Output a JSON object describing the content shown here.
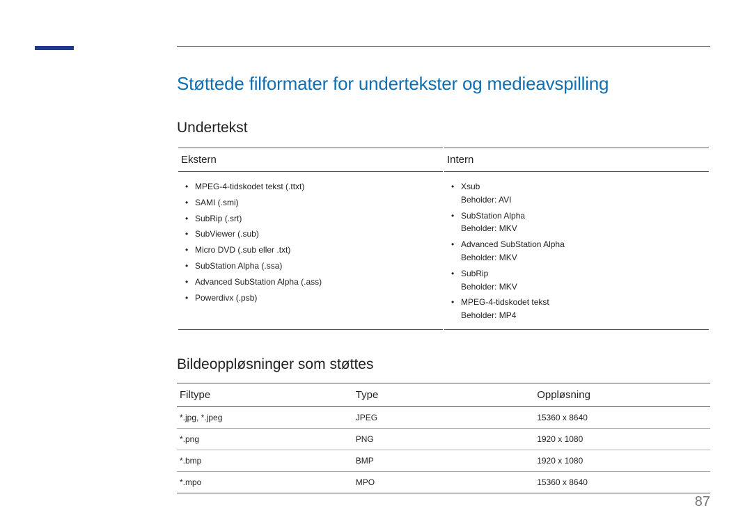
{
  "title": "Støttede filformater for undertekster og medieavspilling",
  "section1": {
    "heading": "Undertekst",
    "col1_header": "Ekstern",
    "col2_header": "Intern",
    "external": [
      {
        "text": "MPEG-4-tidskodet tekst (.ttxt)"
      },
      {
        "text": "SAMI (.smi)"
      },
      {
        "text": "SubRip (.srt)"
      },
      {
        "text": "SubViewer (.sub)"
      },
      {
        "text": "Micro DVD (.sub eller .txt)"
      },
      {
        "text": "SubStation Alpha (.ssa)"
      },
      {
        "text": "Advanced SubStation Alpha (.ass)"
      },
      {
        "text": "Powerdivx (.psb)"
      }
    ],
    "internal": [
      {
        "text": "Xsub",
        "sub": "Beholder: AVI"
      },
      {
        "text": "SubStation Alpha",
        "sub": "Beholder: MKV"
      },
      {
        "text": "Advanced SubStation Alpha",
        "sub": "Beholder: MKV"
      },
      {
        "text": "SubRip",
        "sub": "Beholder: MKV"
      },
      {
        "text": "MPEG-4-tidskodet tekst",
        "sub": "Beholder: MP4"
      }
    ]
  },
  "section2": {
    "heading": "Bildeoppløsninger som støttes",
    "headers": {
      "c1": "Filtype",
      "c2": "Type",
      "c3": "Oppløsning"
    },
    "rows": [
      {
        "c1": "*.jpg, *.jpeg",
        "c2": "JPEG",
        "c3": "15360 x 8640"
      },
      {
        "c1": "*.png",
        "c2": "PNG",
        "c3": "1920 x 1080"
      },
      {
        "c1": "*.bmp",
        "c2": "BMP",
        "c3": "1920 x 1080"
      },
      {
        "c1": "*.mpo",
        "c2": "MPO",
        "c3": "15360 x 8640"
      }
    ]
  },
  "page_number": "87"
}
